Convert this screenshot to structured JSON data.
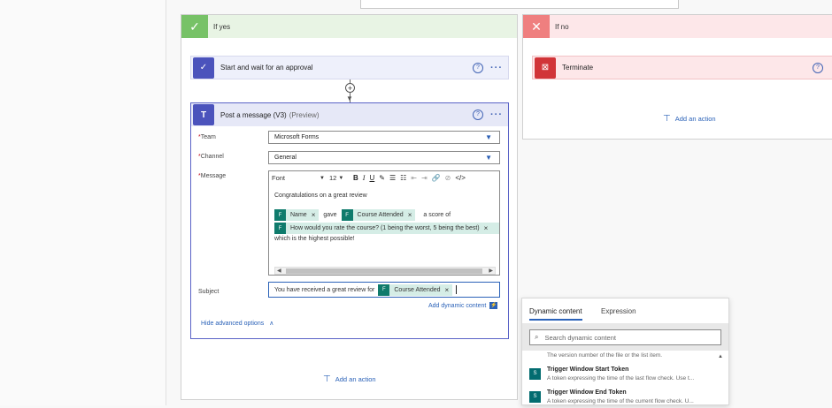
{
  "branches": {
    "yes": {
      "label": "If yes",
      "check_icon": "checkmark-icon",
      "approval": {
        "title": "Start and wait for an approval"
      },
      "post": {
        "title": "Post a message (V3)",
        "preview": "(Preview)",
        "team_label": "Team",
        "team_value": "Microsoft Forms",
        "channel_label": "Channel",
        "channel_value": "General",
        "message_label": "Message",
        "subject_label": "Subject",
        "toolbar": {
          "font": "Font",
          "size": "12",
          "bold": "B",
          "italic": "I",
          "underline": "U"
        },
        "message": {
          "line1": "Congratulations on a great review",
          "token_name": "Name",
          "gave": "gave",
          "token_course": "Course Attended",
          "score_of": "a score of",
          "token_rating": "How would you rate the course? (1 being the worst, 5 being the best)",
          "line_last": "which is the highest possible!"
        },
        "subject": {
          "prefix": "You have received a great review for",
          "token": "Course Attended"
        },
        "add_dynamic": "Add dynamic content",
        "hide_advanced": "Hide advanced options"
      },
      "add_action": "Add an action"
    },
    "no": {
      "label": "If no",
      "terminate": {
        "title": "Terminate"
      },
      "add_action": "Add an action"
    }
  },
  "dynamic_panel": {
    "tabs": [
      "Dynamic content",
      "Expression"
    ],
    "search_placeholder": "Search dynamic content",
    "partial_desc": "The version number of the file or the list item.",
    "items": [
      {
        "title": "Trigger Window Start Token",
        "desc": "A token expressing the time of the last flow check. Use t..."
      },
      {
        "title": "Trigger Window End Token",
        "desc": "A token expressing the time of the current flow check. U..."
      }
    ]
  },
  "colors": {
    "accent": "#2b62b8",
    "teams": "#4b53bc",
    "yes": "#77c267",
    "no": "#ef7f7f",
    "terminate": "#d13438"
  }
}
